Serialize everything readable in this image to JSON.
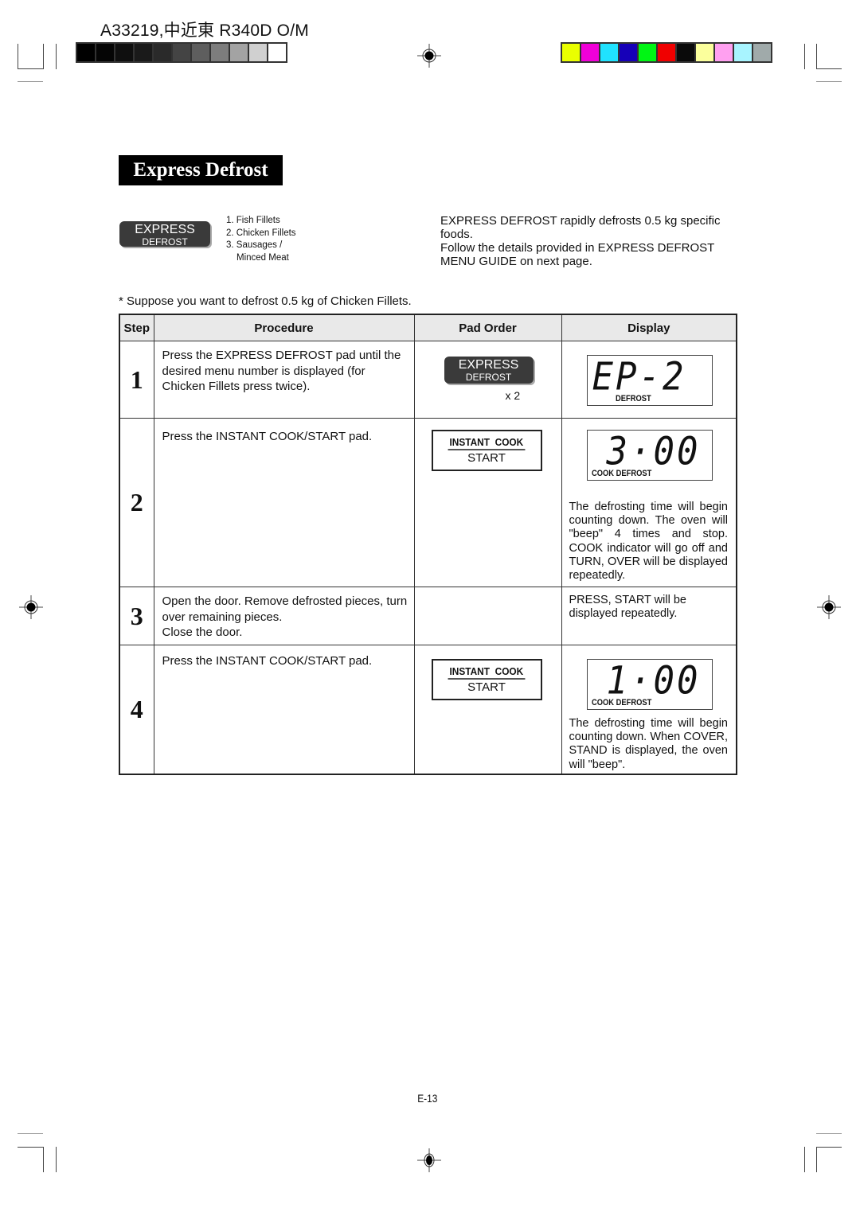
{
  "header": {
    "doc_code": "A33219,中近東 R340D O/M",
    "gray_swatches": [
      "#000000",
      "#050505",
      "#0f0f0f",
      "#1a1a1a",
      "#2a2a2a",
      "#444444",
      "#5e5e5e",
      "#7d7d7d",
      "#a3a3a3",
      "#d0d0d0",
      "#ffffff"
    ],
    "color_swatches": [
      "#eaff00",
      "#f000d8",
      "#20e2ff",
      "#1600b8",
      "#00f614",
      "#f00000",
      "#0a0a0a",
      "#fbff9c",
      "#ffa0f0",
      "#a8f4ff",
      "#a0aaaa"
    ]
  },
  "section": {
    "title": "Express Defrost",
    "pad_label_line1": "EXPRESS",
    "pad_label_line2": "DEFROST",
    "menu": [
      "1. Fish Fillets",
      "2. Chicken Fillets",
      "3. Sausages /",
      "Minced Meat"
    ],
    "intro_line1": "EXPRESS DEFROST rapidly defrosts 0.5 kg specific foods.",
    "intro_line2": "Follow the details provided in EXPRESS DEFROST MENU GUIDE on next page.",
    "suppose": "* Suppose you want to defrost 0.5 kg of Chicken Fillets."
  },
  "table": {
    "headers": [
      "Step",
      "Procedure",
      "Pad Order",
      "Display"
    ],
    "rows": [
      {
        "step": "1",
        "procedure": [
          "Press the EXPRESS DEFROST pad until the desired menu number is displayed (for Chicken Fillets press twice)."
        ],
        "pad": {
          "type": "express",
          "line1": "EXPRESS",
          "line2": "DEFROST",
          "times": "x 2"
        },
        "display": {
          "digits": "EP-2",
          "indicator": "DEFROST"
        },
        "note": ""
      },
      {
        "step": "2",
        "procedure": [
          "Press the INSTANT COOK/START pad."
        ],
        "pad": {
          "type": "instant",
          "line1": "INSTANT  COOK",
          "line2": "START"
        },
        "display": {
          "digits": "3·00",
          "indicator": "COOK DEFROST"
        },
        "note": "The defrosting time will begin counting down. The oven will \"beep\" 4 times and stop. COOK indicator will go off and TURN, OVER will be displayed repeatedly."
      },
      {
        "step": "3",
        "procedure": [
          "Open the door. Remove defrosted pieces, turn over remaining pieces.",
          "Close the door."
        ],
        "pad": null,
        "display": null,
        "note": "PRESS, START will be displayed repeatedly."
      },
      {
        "step": "4",
        "procedure": [
          "Press the INSTANT COOK/START pad."
        ],
        "pad": {
          "type": "instant",
          "line1": "INSTANT  COOK",
          "line2": "START"
        },
        "display": {
          "digits": "1·00",
          "indicator": "COOK DEFROST"
        },
        "note": "The defrosting time will begin counting down. When COVER, STAND is displayed, the oven will \"beep\"."
      }
    ]
  },
  "footer": {
    "page_number": "E-13"
  }
}
